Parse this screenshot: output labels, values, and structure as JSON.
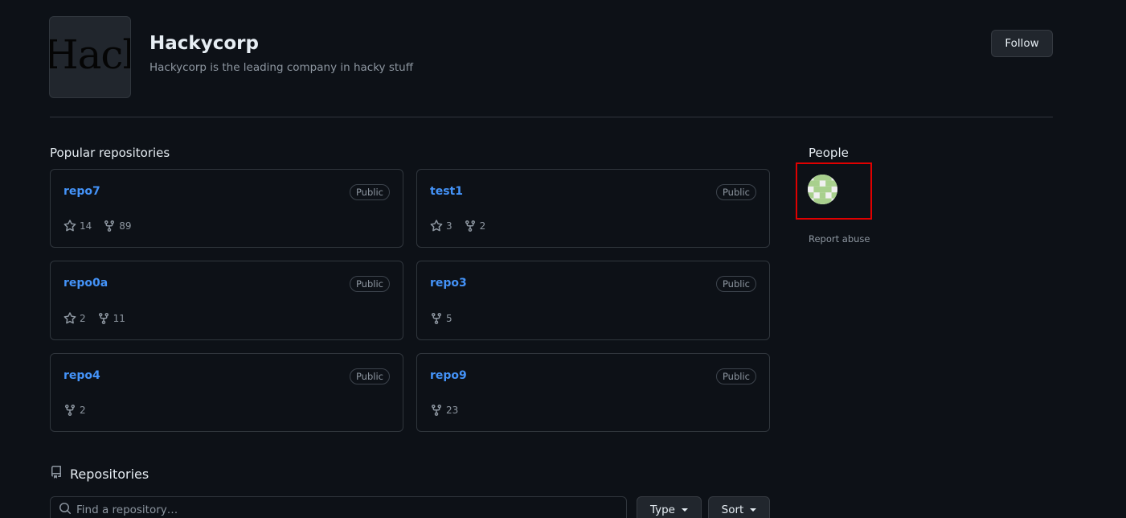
{
  "org": {
    "name": "Hackycorp",
    "description": "Hackycorp is the leading company in hacky stuff",
    "avatar_text": "Hacky",
    "follow_label": "Follow"
  },
  "popular": {
    "title": "Popular repositories",
    "public_label": "Public",
    "repos": [
      {
        "name": "repo7",
        "stars": "14",
        "forks": "89"
      },
      {
        "name": "test1",
        "stars": "3",
        "forks": "2"
      },
      {
        "name": "repo0a",
        "stars": "2",
        "forks": "11"
      },
      {
        "name": "repo3",
        "stars": null,
        "forks": "5"
      },
      {
        "name": "repo4",
        "stars": null,
        "forks": "2"
      },
      {
        "name": "repo9",
        "stars": null,
        "forks": "23"
      }
    ]
  },
  "people": {
    "title": "People",
    "report_label": "Report abuse"
  },
  "repositories": {
    "title": "Repositories",
    "search_placeholder": "Find a repository…",
    "type_label": "Type",
    "sort_label": "Sort"
  },
  "icons": {
    "star": "star-icon",
    "fork": "fork-icon",
    "repo": "repo-icon",
    "search": "search-icon",
    "caret": "caret-down-icon"
  },
  "colors": {
    "background": "#0d1117",
    "link": "#4493f8",
    "muted": "#8d96a0",
    "border": "#30363d",
    "highlight": "#e00000"
  }
}
